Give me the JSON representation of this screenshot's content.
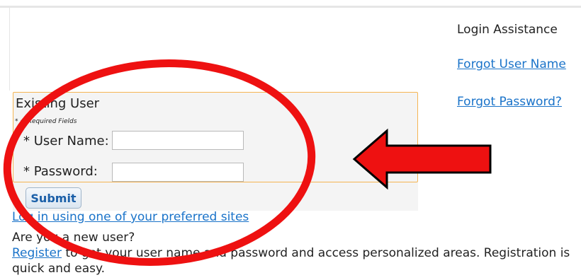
{
  "assistance": {
    "title": "Login Assistance",
    "forgot_username": "Forgot User Name",
    "forgot_password": "Forgot Password?"
  },
  "login": {
    "box_title": "Existing User",
    "required_note": "* = Required Fields",
    "username_label": "* User Name:",
    "username_value": "",
    "password_label": "* Password:",
    "password_value": "",
    "submit_label": "Submit"
  },
  "alternatives": {
    "preferred_sites_link": "Log in using one of your preferred sites",
    "new_user_question": "Are you a new user?",
    "register_link": "Register",
    "register_text": " to get your user name and password and access personalized areas. Registration is quick and easy."
  },
  "annotation_colors": {
    "ellipse": "#ee1111",
    "arrow_fill": "#ee1111",
    "arrow_stroke": "#000000"
  }
}
